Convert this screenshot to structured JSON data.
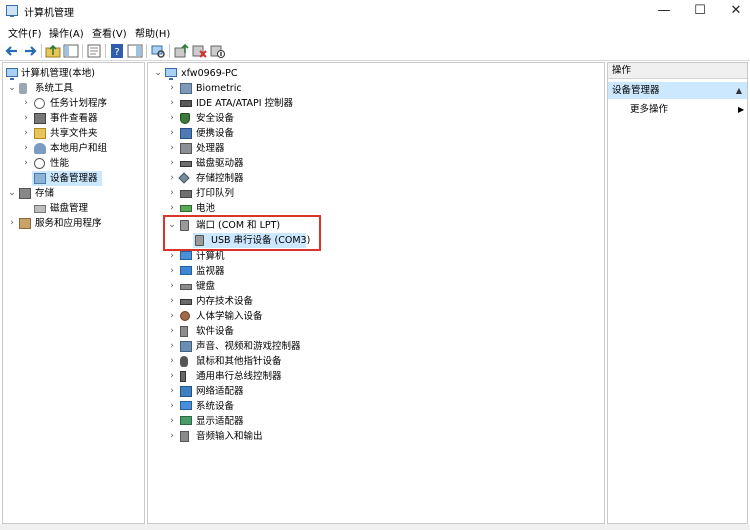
{
  "window": {
    "title": "计算机管理"
  },
  "window_controls": {
    "minimize": "—",
    "maximize": "☐",
    "close": "✕"
  },
  "menu": [
    "文件(F)",
    "操作(A)",
    "查看(V)",
    "帮助(H)"
  ],
  "toolbar": {
    "icons": [
      "back-arrow-icon",
      "forward-arrow-icon",
      "up-folder-icon",
      "show-hide-tree-icon",
      "export-list-icon",
      "help-icon",
      "action-pane-icon",
      "scan-hardware-icon",
      "update-driver-icon",
      "uninstall-device-icon",
      "disable-device-icon"
    ]
  },
  "left_tree": {
    "root": "计算机管理(本地)",
    "groups": [
      {
        "label": "系统工具",
        "expanded": true,
        "children": [
          "任务计划程序",
          "事件查看器",
          "共享文件夹",
          "本地用户和组",
          "性能",
          "设备管理器"
        ]
      },
      {
        "label": "存储",
        "expanded": true,
        "children": [
          "磁盘管理"
        ]
      },
      {
        "label": "服务和应用程序",
        "expanded": false,
        "children": []
      }
    ],
    "selected": "设备管理器"
  },
  "device_tree": {
    "root": "xfw0969-PC",
    "categories": [
      "Biometric",
      "IDE ATA/ATAPI 控制器",
      "安全设备",
      "便携设备",
      "处理器",
      "磁盘驱动器",
      "存储控制器",
      "打印队列",
      "电池",
      "端口 (COM 和 LPT)",
      "计算机",
      "监视器",
      "键盘",
      "内存技术设备",
      "人体学输入设备",
      "软件设备",
      "声音、视频和游戏控制器",
      "鼠标和其他指针设备",
      "通用串行总线控制器",
      "网络适配器",
      "系统设备",
      "显示适配器",
      "音频输入和输出"
    ],
    "expanded_category": "端口 (COM 和 LPT)",
    "expanded_child": "USB 串行设备 (COM3)"
  },
  "actions_pane": {
    "header": "操作",
    "section": "设备管理器",
    "section_collapse": "▲",
    "more_actions": "更多操作",
    "more_arrow": "▶"
  },
  "colors": {
    "selection": "#cce8ff",
    "highlight_box": "#d9342b",
    "pane_border": "#c9c9c9"
  }
}
